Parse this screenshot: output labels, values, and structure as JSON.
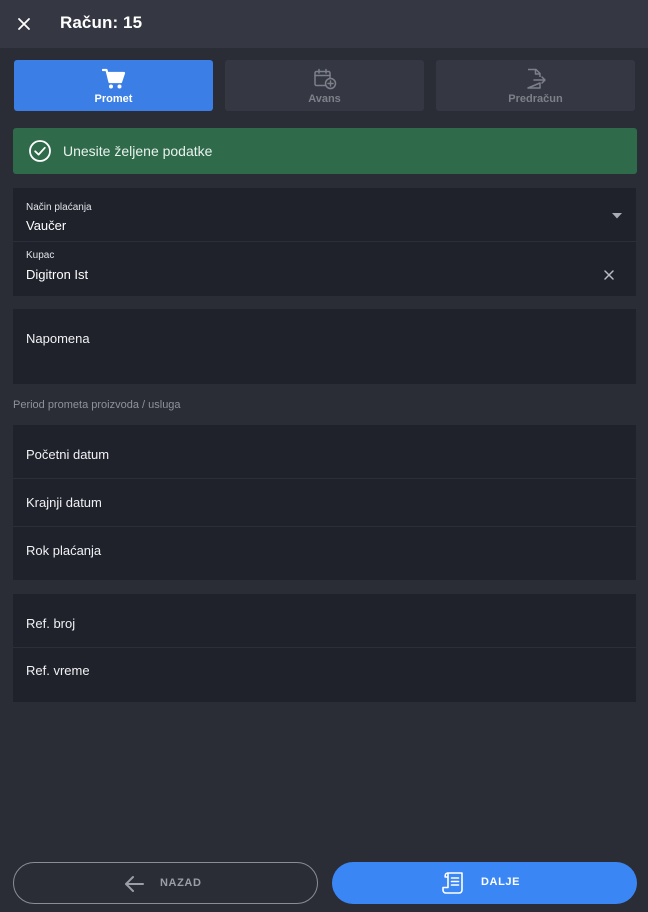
{
  "header": {
    "title": "Račun: 15",
    "close_icon": "close-icon"
  },
  "tabs": [
    {
      "label": "Promet",
      "icon": "cart-icon",
      "active": true
    },
    {
      "label": "Avans",
      "icon": "calendar-add-icon",
      "active": false
    },
    {
      "label": "Predračun",
      "icon": "document-export-icon",
      "active": false
    }
  ],
  "alert": {
    "text": "Unesite željene podatke",
    "icon": "check-circle-icon",
    "color": "#2f6a4b"
  },
  "payment": {
    "label": "Način plaćanja",
    "value": "Vaučer"
  },
  "customer": {
    "label": "Kupac",
    "value": "Digitron Ist"
  },
  "note": {
    "label": "Napomena"
  },
  "period": {
    "caption": "Period prometa proizvoda / usluga",
    "start_label": "Početni datum",
    "end_label": "Krajnji datum",
    "due_label": "Rok plaćanja"
  },
  "reference": {
    "number_label": "Ref. broj",
    "time_label": "Ref. vreme"
  },
  "footer": {
    "back_label": "NAZAD",
    "next_label": "DALJE"
  },
  "colors": {
    "accent": "#3b86f5",
    "background": "#2a2d36",
    "card": "#1f222b",
    "success": "#2f6a4b"
  }
}
